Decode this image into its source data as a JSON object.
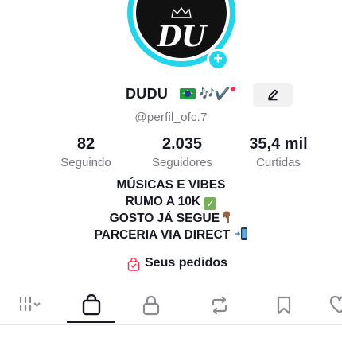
{
  "profile": {
    "avatar_text": "DU",
    "username": "DUDU",
    "username_suffix": "🎶✔️",
    "handle": "@perfil_ofc.7"
  },
  "stats": [
    {
      "value": "82",
      "label": "Seguindo"
    },
    {
      "value": "2.035",
      "label": "Seguidores"
    },
    {
      "value": "35,4 mil",
      "label": "Curtidas"
    }
  ],
  "bio": {
    "line1": "MÚSICAS E VIBES",
    "line2": "RUMO A 10K",
    "line3": "GOSTO JÁ SEGUE",
    "line4": "PARCERIA VIA DIRECT"
  },
  "orders": {
    "label": "Seus pedidos"
  },
  "tabs": [
    {
      "icon": "grid-icon",
      "active": false
    },
    {
      "icon": "shopping-bag-icon",
      "active": true
    },
    {
      "icon": "lock-icon",
      "active": false
    },
    {
      "icon": "repost-icon",
      "active": false
    },
    {
      "icon": "bookmark-icon",
      "active": false
    },
    {
      "icon": "heart-icon",
      "active": false
    }
  ],
  "colors": {
    "accent": "#20d5ec",
    "text": "#161823",
    "muted": "#75777f",
    "notification": "#fe2c55"
  }
}
